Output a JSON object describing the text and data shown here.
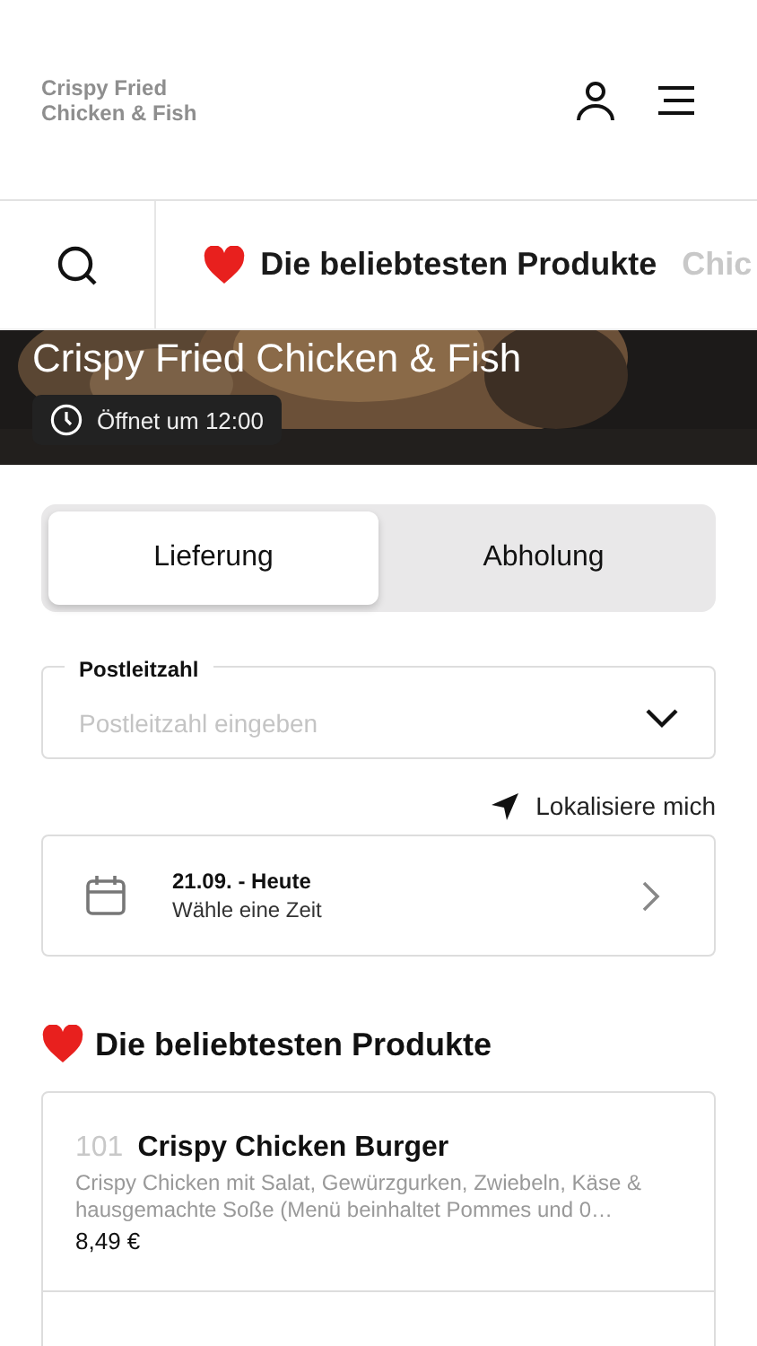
{
  "header": {
    "restaurant_name": "Crispy Fried\nChicken & Fish"
  },
  "category_tabs": [
    {
      "label": "Die beliebtesten Produkte",
      "kind": "favorites",
      "selected": true
    },
    {
      "label": "Chic",
      "kind": "category",
      "selected": false
    }
  ],
  "hero": {
    "title": "Crispy Fried Chicken & Fish",
    "opening_badge": "Öffnet um 12:00"
  },
  "order_mode": [
    {
      "label": "Lieferung",
      "selected": true
    },
    {
      "label": "Abholung",
      "selected": false
    }
  ],
  "postcode_field": {
    "label": "Postleitzahl",
    "placeholder": "Postleitzahl eingeben"
  },
  "locate_link": "Lokalisiere mich",
  "time_picker": {
    "date": "21.09. - Heute",
    "hint": "Wähle eine Zeit"
  },
  "section": {
    "title": "Die beliebtesten Produkte"
  },
  "products": [
    {
      "number": "101",
      "name": "Crispy Chicken Burger",
      "description": "Crispy Chicken mit Salat, Gewürzgurken, Zwiebeln, Käse & hausgemachte Soße (Menü beinhaltet Pommes und 0…",
      "price": "8,49 €"
    }
  ]
}
